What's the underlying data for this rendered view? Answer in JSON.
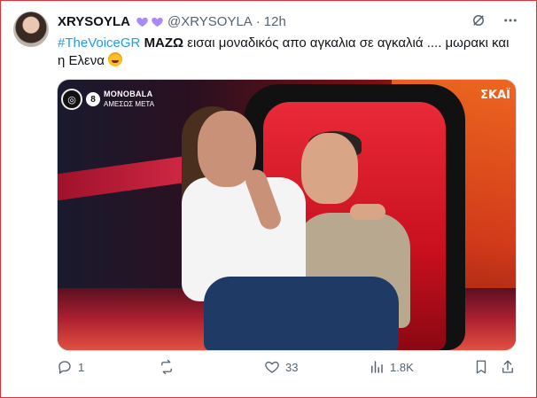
{
  "tweet": {
    "display_name": "XRYSOYLA",
    "handle": "@XRYSOYLA",
    "separator": "·",
    "time": "12h",
    "text": {
      "hashtag": "#TheVoiceGR",
      "bold": "ΜΑΖΩ",
      "body": " εισαι μοναδικός απο αγκαλια σε αγκαλιά .... μωρακι και η Ελενα "
    }
  },
  "media": {
    "badge_number": "8",
    "badge_title": "MONOBALA",
    "badge_subtitle": "ΑΜΕΣΩΣ ΜΕΤΑ",
    "channel_logo": "ΣΚΑΪ"
  },
  "actions": {
    "replies": "1",
    "retweets": "",
    "likes": "33",
    "views": "1.8K"
  },
  "icons": {
    "heart_emoji": "purple-heart-icon",
    "grok": "grok-icon",
    "more": "more-dots-icon",
    "reply": "reply-icon",
    "retweet": "retweet-icon",
    "like": "like-icon",
    "views": "views-icon",
    "bookmark": "bookmark-icon",
    "share": "share-icon"
  },
  "colors": {
    "accent": "#1d9bf0",
    "muted": "#536471",
    "heart": "#a78bfa",
    "frame": "#e0303a"
  }
}
